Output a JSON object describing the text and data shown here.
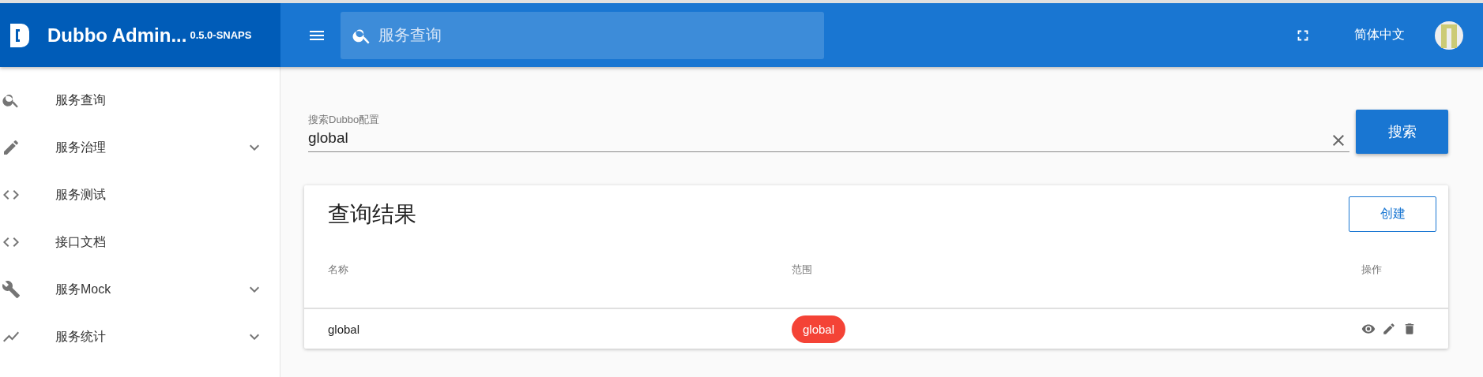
{
  "brand": {
    "title": "Dubbo Admin...",
    "version": "0.5.0-SNAPS"
  },
  "header": {
    "search_placeholder": "服务查询",
    "language": "简体中文"
  },
  "sidebar": {
    "items": [
      {
        "label": "服务查询",
        "kind": "link"
      },
      {
        "label": "服务治理",
        "kind": "group",
        "expanded": false
      },
      {
        "label": "服务测试",
        "kind": "link"
      },
      {
        "label": "接口文档",
        "kind": "link"
      },
      {
        "label": "服务Mock",
        "kind": "group",
        "expanded": false
      },
      {
        "label": "服务统计",
        "kind": "group",
        "expanded": false
      }
    ]
  },
  "search": {
    "label": "搜索Dubbo配置",
    "value": "global",
    "button": "搜索"
  },
  "results": {
    "title": "查询结果",
    "create_button": "创建",
    "columns": [
      "名称",
      "范围",
      "操作"
    ],
    "rows": [
      {
        "name": "global",
        "scope": "global"
      }
    ]
  }
}
